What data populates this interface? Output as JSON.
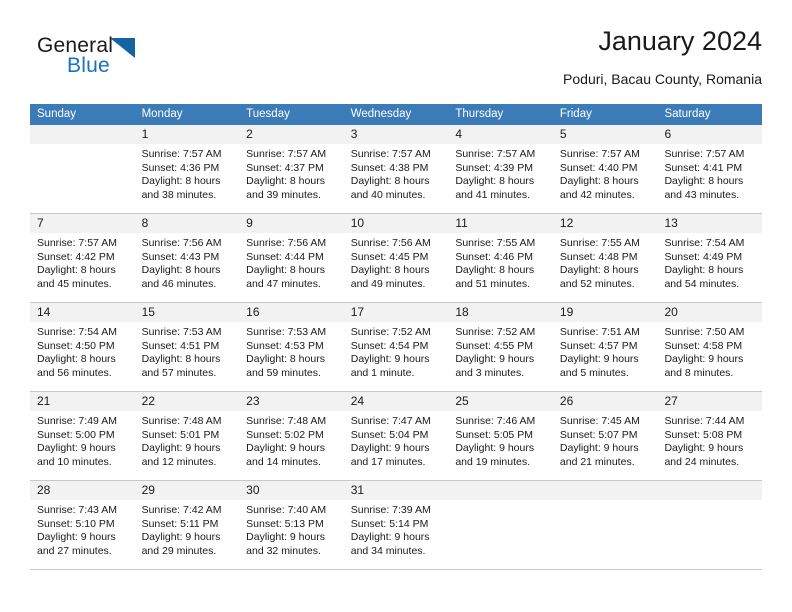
{
  "logo": {
    "word_top": "General",
    "word_bottom": "Blue",
    "triangle_color": "#1464a5",
    "blue_color": "#1673bf"
  },
  "header": {
    "title": "January 2024",
    "subtitle": "Poduri, Bacau County, Romania"
  },
  "theme": {
    "header_bar": "#3b7cb8",
    "daynum_bg": "#f2f2f2",
    "grid_line": "#c8c8c8",
    "text": "#1a1a1a"
  },
  "weekdays": [
    "Sunday",
    "Monday",
    "Tuesday",
    "Wednesday",
    "Thursday",
    "Friday",
    "Saturday"
  ],
  "weeks": [
    {
      "days": [
        {
          "num": "",
          "lines": []
        },
        {
          "num": "1",
          "lines": [
            "Sunrise: 7:57 AM",
            "Sunset: 4:36 PM",
            "Daylight: 8 hours",
            "and 38 minutes."
          ]
        },
        {
          "num": "2",
          "lines": [
            "Sunrise: 7:57 AM",
            "Sunset: 4:37 PM",
            "Daylight: 8 hours",
            "and 39 minutes."
          ]
        },
        {
          "num": "3",
          "lines": [
            "Sunrise: 7:57 AM",
            "Sunset: 4:38 PM",
            "Daylight: 8 hours",
            "and 40 minutes."
          ]
        },
        {
          "num": "4",
          "lines": [
            "Sunrise: 7:57 AM",
            "Sunset: 4:39 PM",
            "Daylight: 8 hours",
            "and 41 minutes."
          ]
        },
        {
          "num": "5",
          "lines": [
            "Sunrise: 7:57 AM",
            "Sunset: 4:40 PM",
            "Daylight: 8 hours",
            "and 42 minutes."
          ]
        },
        {
          "num": "6",
          "lines": [
            "Sunrise: 7:57 AM",
            "Sunset: 4:41 PM",
            "Daylight: 8 hours",
            "and 43 minutes."
          ]
        }
      ]
    },
    {
      "days": [
        {
          "num": "7",
          "lines": [
            "Sunrise: 7:57 AM",
            "Sunset: 4:42 PM",
            "Daylight: 8 hours",
            "and 45 minutes."
          ]
        },
        {
          "num": "8",
          "lines": [
            "Sunrise: 7:56 AM",
            "Sunset: 4:43 PM",
            "Daylight: 8 hours",
            "and 46 minutes."
          ]
        },
        {
          "num": "9",
          "lines": [
            "Sunrise: 7:56 AM",
            "Sunset: 4:44 PM",
            "Daylight: 8 hours",
            "and 47 minutes."
          ]
        },
        {
          "num": "10",
          "lines": [
            "Sunrise: 7:56 AM",
            "Sunset: 4:45 PM",
            "Daylight: 8 hours",
            "and 49 minutes."
          ]
        },
        {
          "num": "11",
          "lines": [
            "Sunrise: 7:55 AM",
            "Sunset: 4:46 PM",
            "Daylight: 8 hours",
            "and 51 minutes."
          ]
        },
        {
          "num": "12",
          "lines": [
            "Sunrise: 7:55 AM",
            "Sunset: 4:48 PM",
            "Daylight: 8 hours",
            "and 52 minutes."
          ]
        },
        {
          "num": "13",
          "lines": [
            "Sunrise: 7:54 AM",
            "Sunset: 4:49 PM",
            "Daylight: 8 hours",
            "and 54 minutes."
          ]
        }
      ]
    },
    {
      "days": [
        {
          "num": "14",
          "lines": [
            "Sunrise: 7:54 AM",
            "Sunset: 4:50 PM",
            "Daylight: 8 hours",
            "and 56 minutes."
          ]
        },
        {
          "num": "15",
          "lines": [
            "Sunrise: 7:53 AM",
            "Sunset: 4:51 PM",
            "Daylight: 8 hours",
            "and 57 minutes."
          ]
        },
        {
          "num": "16",
          "lines": [
            "Sunrise: 7:53 AM",
            "Sunset: 4:53 PM",
            "Daylight: 8 hours",
            "and 59 minutes."
          ]
        },
        {
          "num": "17",
          "lines": [
            "Sunrise: 7:52 AM",
            "Sunset: 4:54 PM",
            "Daylight: 9 hours",
            "and 1 minute."
          ]
        },
        {
          "num": "18",
          "lines": [
            "Sunrise: 7:52 AM",
            "Sunset: 4:55 PM",
            "Daylight: 9 hours",
            "and 3 minutes."
          ]
        },
        {
          "num": "19",
          "lines": [
            "Sunrise: 7:51 AM",
            "Sunset: 4:57 PM",
            "Daylight: 9 hours",
            "and 5 minutes."
          ]
        },
        {
          "num": "20",
          "lines": [
            "Sunrise: 7:50 AM",
            "Sunset: 4:58 PM",
            "Daylight: 9 hours",
            "and 8 minutes."
          ]
        }
      ]
    },
    {
      "days": [
        {
          "num": "21",
          "lines": [
            "Sunrise: 7:49 AM",
            "Sunset: 5:00 PM",
            "Daylight: 9 hours",
            "and 10 minutes."
          ]
        },
        {
          "num": "22",
          "lines": [
            "Sunrise: 7:48 AM",
            "Sunset: 5:01 PM",
            "Daylight: 9 hours",
            "and 12 minutes."
          ]
        },
        {
          "num": "23",
          "lines": [
            "Sunrise: 7:48 AM",
            "Sunset: 5:02 PM",
            "Daylight: 9 hours",
            "and 14 minutes."
          ]
        },
        {
          "num": "24",
          "lines": [
            "Sunrise: 7:47 AM",
            "Sunset: 5:04 PM",
            "Daylight: 9 hours",
            "and 17 minutes."
          ]
        },
        {
          "num": "25",
          "lines": [
            "Sunrise: 7:46 AM",
            "Sunset: 5:05 PM",
            "Daylight: 9 hours",
            "and 19 minutes."
          ]
        },
        {
          "num": "26",
          "lines": [
            "Sunrise: 7:45 AM",
            "Sunset: 5:07 PM",
            "Daylight: 9 hours",
            "and 21 minutes."
          ]
        },
        {
          "num": "27",
          "lines": [
            "Sunrise: 7:44 AM",
            "Sunset: 5:08 PM",
            "Daylight: 9 hours",
            "and 24 minutes."
          ]
        }
      ]
    },
    {
      "days": [
        {
          "num": "28",
          "lines": [
            "Sunrise: 7:43 AM",
            "Sunset: 5:10 PM",
            "Daylight: 9 hours",
            "and 27 minutes."
          ]
        },
        {
          "num": "29",
          "lines": [
            "Sunrise: 7:42 AM",
            "Sunset: 5:11 PM",
            "Daylight: 9 hours",
            "and 29 minutes."
          ]
        },
        {
          "num": "30",
          "lines": [
            "Sunrise: 7:40 AM",
            "Sunset: 5:13 PM",
            "Daylight: 9 hours",
            "and 32 minutes."
          ]
        },
        {
          "num": "31",
          "lines": [
            "Sunrise: 7:39 AM",
            "Sunset: 5:14 PM",
            "Daylight: 9 hours",
            "and 34 minutes."
          ]
        },
        {
          "num": "",
          "lines": []
        },
        {
          "num": "",
          "lines": []
        },
        {
          "num": "",
          "lines": []
        }
      ]
    }
  ]
}
